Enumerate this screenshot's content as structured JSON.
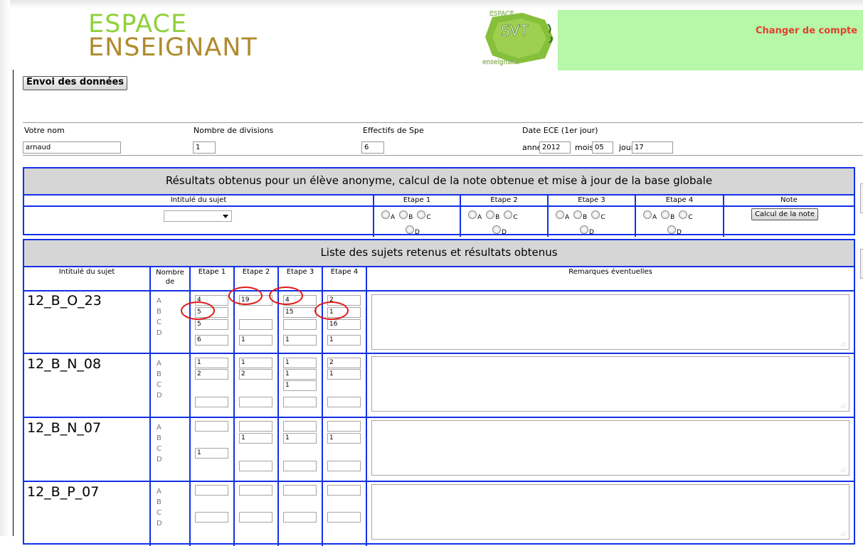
{
  "header": {
    "logo_line1": "ESPACE",
    "logo_line2": "ENSEIGNANT",
    "svt_logo_top": "ESPACE",
    "svt_logo_mid": "SVT",
    "svt_logo_bottom": "enseignant",
    "change_account": "Changer de compte",
    "colors": {
      "banner": "#b6f7a8",
      "logo_green": "#8fd13b",
      "logo_gold": "#b08a2e",
      "link_red": "#e0412e",
      "table_blue": "#1230e8"
    }
  },
  "send_button": "Envoi des données",
  "form": {
    "name_label": "Votre nom",
    "name_value": "arnaud",
    "divisions_label": "Nombre de divisions",
    "divisions_value": "1",
    "spe_label": "Effectifs de Spe",
    "spe_value": "6",
    "date_label": "Date ECE (1er jour)",
    "year_label": "année",
    "year_value": "2012",
    "month_label": "mois",
    "month_value": "05",
    "day_label": "jour",
    "day_value": "17"
  },
  "results_panel": {
    "title": "Résultats obtenus pour un élève anonyme, calcul de la note obtenue et mise à jour de la base globale",
    "col_subject": "Intitulé du sujet",
    "steps": [
      "Etape 1",
      "Etape 2",
      "Etape 3",
      "Etape 4"
    ],
    "col_note": "Note",
    "radio_letters": [
      "A",
      "B",
      "C",
      "D"
    ],
    "compute_button": "Calcul de la note"
  },
  "list_panel": {
    "title": "Liste des sujets retenus et résultats obtenus",
    "col_subject": "Intitulé du sujet",
    "col_count": "Nombre de",
    "steps": [
      "Etape 1",
      "Etape 2",
      "Etape 3",
      "Etape 4"
    ],
    "col_remarks": "Remarques éventuelles",
    "letters": [
      "A",
      "B",
      "C",
      "D"
    ],
    "subjects": [
      {
        "name": "12_B_O_23",
        "cells": [
          [
            "4",
            "5",
            "5",
            "6"
          ],
          [
            "19",
            "",
            "",
            "1"
          ],
          [
            "4",
            "15",
            "",
            "1"
          ],
          [
            "2",
            "1",
            "16",
            "1"
          ]
        ]
      },
      {
        "name": "12_B_N_08",
        "cells": [
          [
            "1",
            "2",
            "",
            ""
          ],
          [
            "1",
            "2",
            "",
            ""
          ],
          [
            "1",
            "1",
            "1",
            ""
          ],
          [
            "2",
            "1",
            "",
            ""
          ]
        ]
      },
      {
        "name": "12_B_N_07",
        "cells": [
          [
            "",
            "",
            "1",
            ""
          ],
          [
            "",
            "1",
            "",
            ""
          ],
          [
            "",
            "1",
            "",
            ""
          ],
          [
            "",
            "1",
            "",
            ""
          ]
        ]
      },
      {
        "name": "12_B_P_07",
        "cells": [
          [
            "",
            "",
            "",
            ""
          ],
          [
            "",
            "",
            "",
            ""
          ],
          [
            "",
            "",
            "",
            ""
          ],
          [
            "",
            "",
            "",
            ""
          ]
        ]
      }
    ]
  }
}
